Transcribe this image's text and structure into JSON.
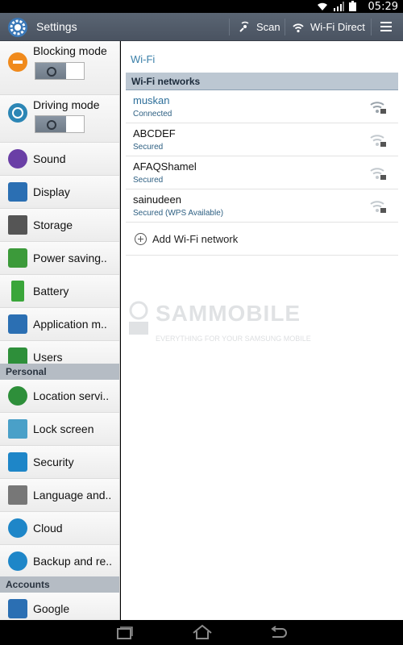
{
  "status_bar": {
    "time": "05:29"
  },
  "action_bar": {
    "title": "Settings",
    "scan_label": "Scan",
    "wifi_direct_label": "Wi-Fi Direct"
  },
  "sidebar": {
    "items": [
      {
        "label": "Blocking mode",
        "icon": "blocking-mode-icon",
        "color": "#f08a1c"
      },
      {
        "label": "Driving mode",
        "icon": "driving-mode-icon",
        "color": "#2c86b5"
      },
      {
        "label": "Sound",
        "icon": "sound-icon",
        "color": "#6a3fa6"
      },
      {
        "label": "Display",
        "icon": "display-icon",
        "color": "#2b6fb3"
      },
      {
        "label": "Storage",
        "icon": "storage-icon",
        "color": "#555555"
      },
      {
        "label": "Power saving..",
        "icon": "power-saving-icon",
        "color": "#3c9a3a"
      },
      {
        "label": "Battery",
        "icon": "battery-icon",
        "color": "#3aa63a"
      },
      {
        "label": "Application m..",
        "icon": "application-manager-icon",
        "color": "#2b6fb3"
      },
      {
        "label": "Users",
        "icon": "users-icon",
        "color": "#2e8f3a"
      }
    ],
    "personal_header": "Personal",
    "personal_items": [
      {
        "label": "Location servi..",
        "icon": "location-icon",
        "color": "#2e8f3a"
      },
      {
        "label": "Lock screen",
        "icon": "lock-screen-icon",
        "color": "#4aa0c8"
      },
      {
        "label": "Security",
        "icon": "security-icon",
        "color": "#1e86c8"
      },
      {
        "label": "Language and..",
        "icon": "language-icon",
        "color": "#777777"
      },
      {
        "label": "Cloud",
        "icon": "cloud-icon",
        "color": "#1e86c8"
      },
      {
        "label": "Backup and re..",
        "icon": "backup-icon",
        "color": "#1e86c8"
      }
    ],
    "accounts_header": "Accounts",
    "account_items": [
      {
        "label": "Google",
        "icon": "google-icon",
        "color": "#2b6fb3"
      }
    ]
  },
  "main": {
    "breadcrumb": "Wi-Fi",
    "networks_header": "Wi-Fi networks",
    "networks": [
      {
        "ssid": "muskan",
        "status": "Connected"
      },
      {
        "ssid": "ABCDEF",
        "status": "Secured"
      },
      {
        "ssid": "AFAQShamel",
        "status": "Secured"
      },
      {
        "ssid": "sainudeen",
        "status": "Secured (WPS Available)"
      }
    ],
    "add_network_label": "Add Wi-Fi network",
    "watermark_title": "SAMMOBILE",
    "watermark_sub": "EVERYTHING FOR YOUR SAMSUNG MOBILE"
  },
  "colors": {
    "accent": "#3a7fa8",
    "action_bar": "#4f5967",
    "section_header": "#bcc7d2"
  }
}
